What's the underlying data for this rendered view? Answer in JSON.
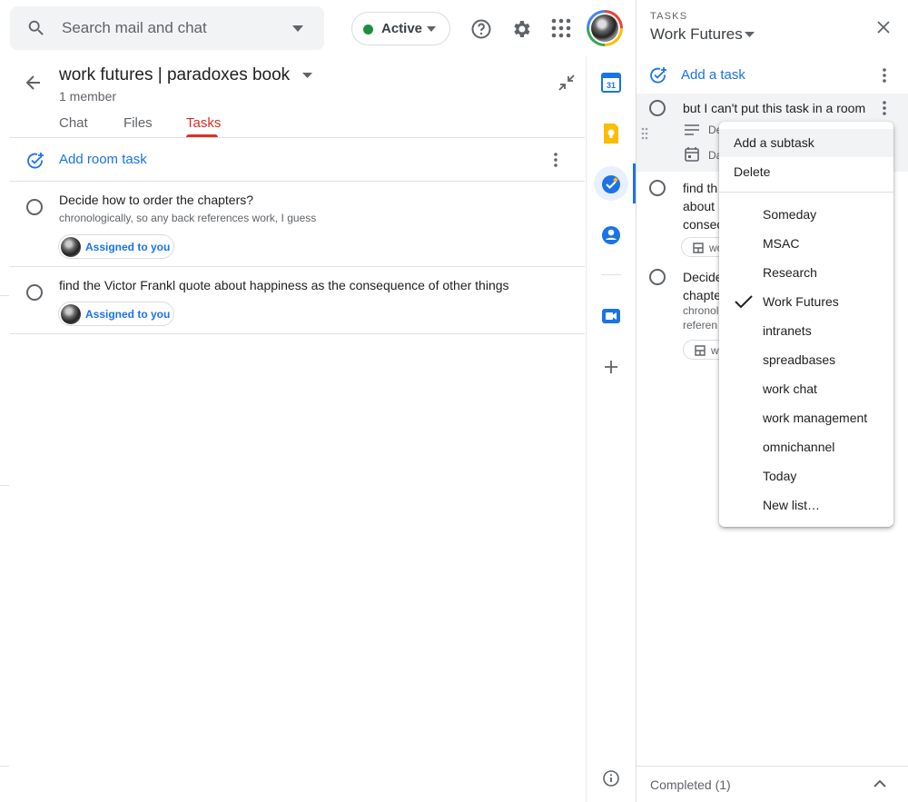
{
  "search": {
    "placeholder": "Search mail and chat"
  },
  "status": {
    "label": "Active",
    "color": "#1e8e3e"
  },
  "room": {
    "title": "work futures | paradoxes book",
    "members": "1 member",
    "tabs": [
      "Chat",
      "Files",
      "Tasks"
    ],
    "active_tab": "Tasks",
    "add_task_label": "Add room task",
    "tasks": [
      {
        "title": "Decide how to order the chapters?",
        "description": "chronologically, so any back references work, I guess",
        "assignee": "Assigned to you"
      },
      {
        "title": "find the Victor Frankl quote about happiness as the consequence of other things",
        "description": "",
        "assignee": "Assigned to you"
      }
    ]
  },
  "rail": {
    "icons": [
      "calendar-icon",
      "keep-icon",
      "tasks-icon",
      "contacts-icon",
      "meet-icon",
      "add-icon",
      "info-icon"
    ],
    "calendar_day": "31"
  },
  "tasks_panel": {
    "eyebrow": "TASKS",
    "list_name": "Work Futures",
    "add_task_label": "Add a task",
    "tasks": [
      {
        "title": "but I can't put this task in a room",
        "detail1": "De",
        "detail2": "Da"
      },
      {
        "lines": [
          "find th",
          "about",
          "consec"
        ],
        "chip": "wo"
      },
      {
        "lines": [
          "Decide",
          "chapte"
        ],
        "desc_lines": [
          "chronol",
          "referen"
        ],
        "chip": "w"
      }
    ],
    "completed_label": "Completed (1)"
  },
  "menu": {
    "actions": [
      "Add a subtask",
      "Delete"
    ],
    "lists": [
      "Someday",
      "MSAC",
      "Research",
      "Work Futures",
      "intranets",
      "spreadbases",
      "work chat",
      "work management",
      "omnichannel",
      "Today",
      "New list…"
    ],
    "checked": "Work Futures"
  },
  "colors": {
    "accent": "#1a73e8",
    "tab_active": "#d93025"
  }
}
